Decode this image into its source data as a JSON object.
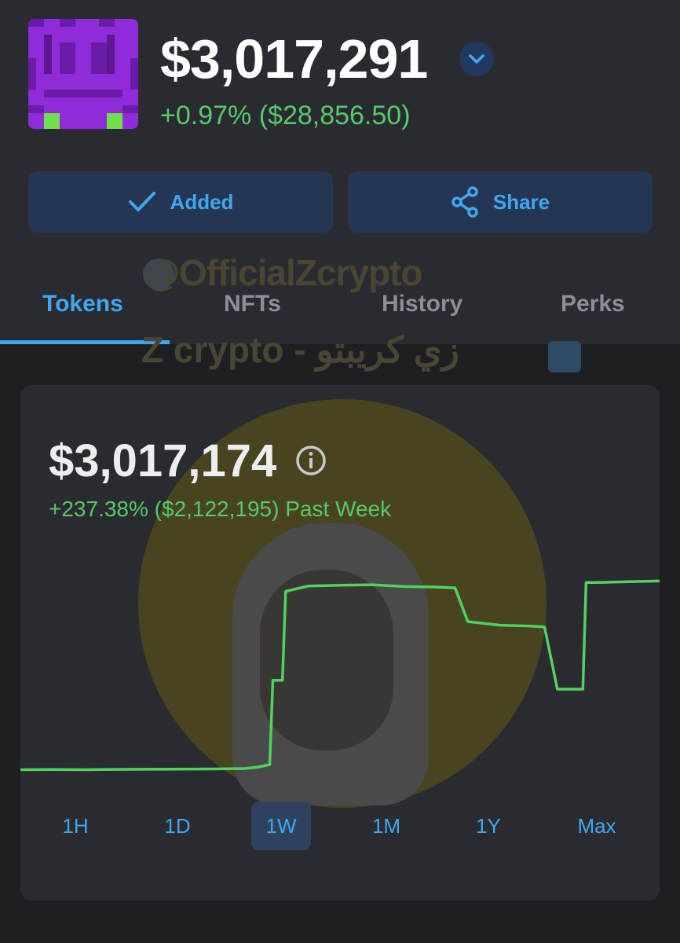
{
  "header": {
    "balance": "$3,017,291",
    "change": "+0.97% ($28,856.50)"
  },
  "actions": {
    "added_label": "Added",
    "share_label": "Share"
  },
  "tabs": [
    {
      "label": "Tokens",
      "active": true
    },
    {
      "label": "NFTs",
      "active": false
    },
    {
      "label": "History",
      "active": false
    },
    {
      "label": "Perks",
      "active": false
    }
  ],
  "watermark": {
    "handle": "@OfficialZcrypto",
    "brand": "Z crypto - زي كريبتو"
  },
  "card": {
    "value": "$3,017,174",
    "change": "+237.38% ($2,122,195) Past Week"
  },
  "ranges": [
    {
      "label": "1H",
      "active": false
    },
    {
      "label": "1D",
      "active": false
    },
    {
      "label": "1W",
      "active": true
    },
    {
      "label": "1M",
      "active": false
    },
    {
      "label": "1Y",
      "active": false
    },
    {
      "label": "Max",
      "active": false
    }
  ],
  "colors": {
    "accent": "#3fa7f0",
    "positive": "#56c96a",
    "background": "#1e1f22",
    "panel": "#2a2b30"
  },
  "icons": {
    "chevron": "chevron-down-icon",
    "check": "check-icon",
    "share": "share-icon",
    "info": "info-icon"
  },
  "chart_data": {
    "type": "line",
    "title": "",
    "xlabel": "",
    "ylabel": "",
    "x": [
      0,
      0.05,
      0.1,
      0.15,
      0.2,
      0.25,
      0.3,
      0.35,
      0.37,
      0.39,
      0.395,
      0.41,
      0.415,
      0.45,
      0.5,
      0.55,
      0.6,
      0.65,
      0.68,
      0.7,
      0.75,
      0.8,
      0.82,
      0.84,
      0.88,
      0.885,
      0.9,
      0.95,
      1.0
    ],
    "series": [
      {
        "values": [
          893,
          895,
          893,
          896,
          898,
          900,
          902,
          906,
          920,
          950,
          1900,
          1900,
          2900,
          2960,
          2970,
          2975,
          2955,
          2950,
          2940,
          2560,
          2520,
          2510,
          2500,
          1800,
          1800,
          3000,
          3000,
          3010,
          3017
        ]
      }
    ]
  }
}
